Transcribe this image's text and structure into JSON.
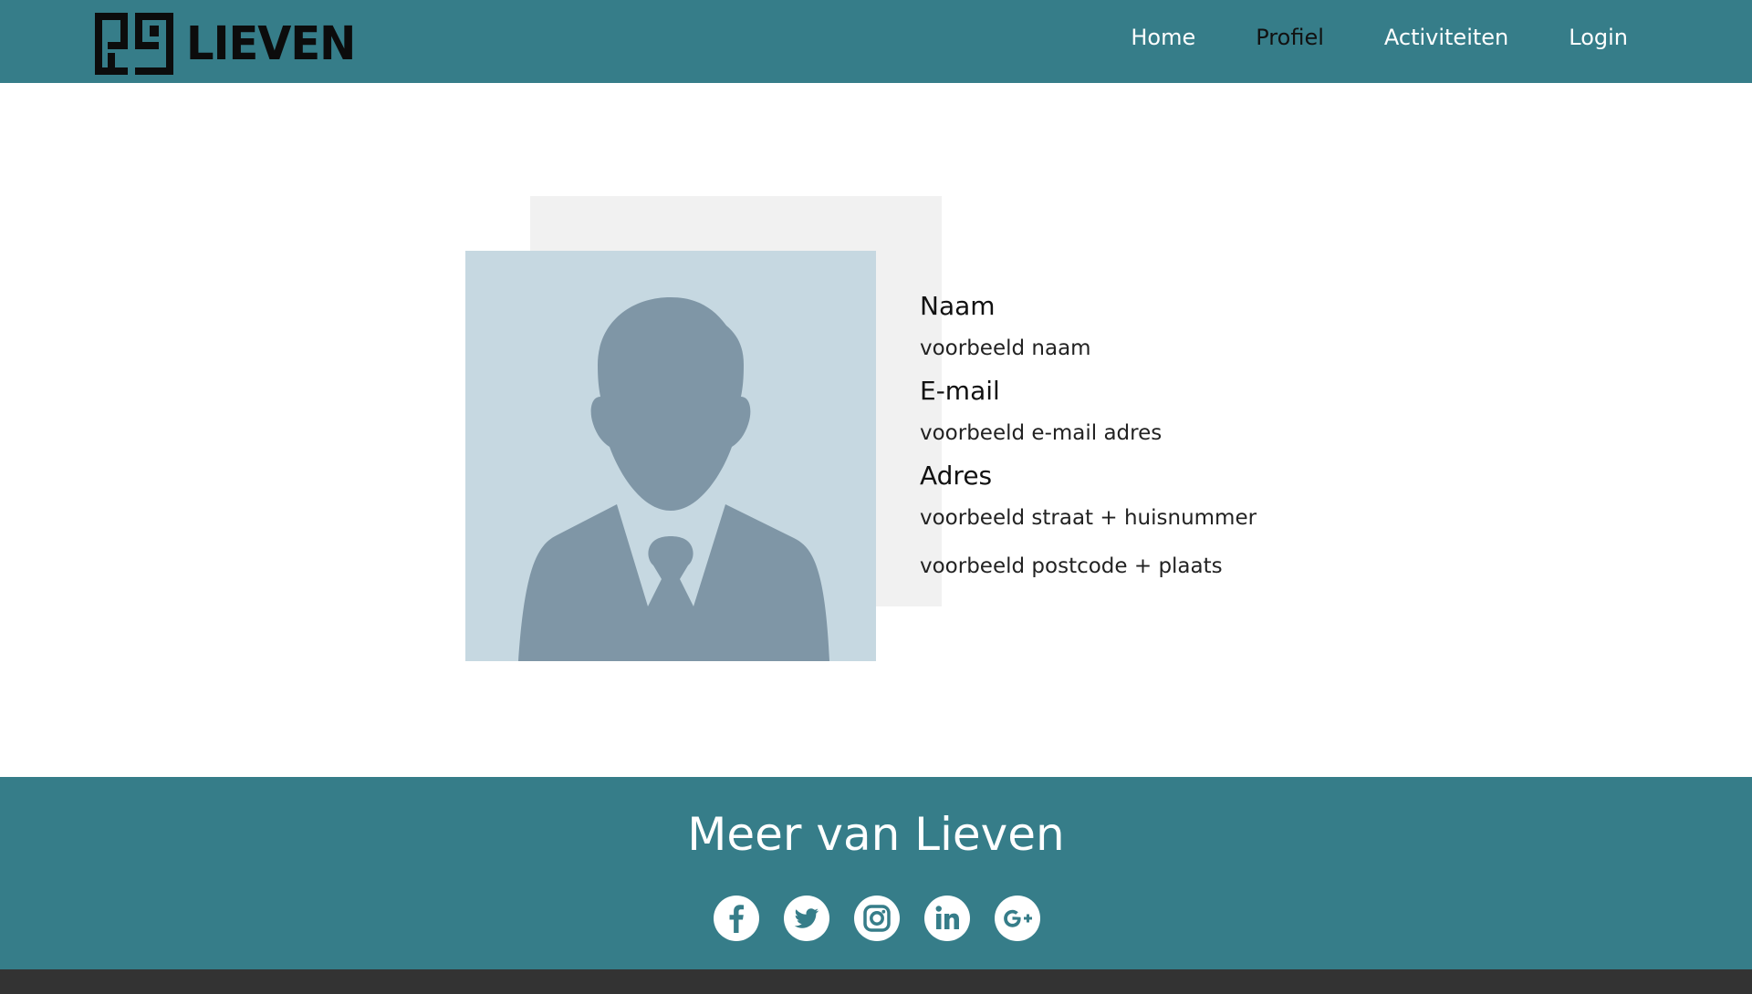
{
  "brand": {
    "name": "LIEVEN"
  },
  "nav": {
    "items": [
      {
        "label": "Home",
        "active": false
      },
      {
        "label": "Profiel",
        "active": true
      },
      {
        "label": "Activiteiten",
        "active": false
      },
      {
        "label": "Login",
        "active": false
      }
    ]
  },
  "profile": {
    "name_heading": "Naam",
    "name_value": "voorbeeld naam",
    "email_heading": "E-mail",
    "email_value": "voorbeeld e-mail adres",
    "address_heading": "Adres",
    "address_street": "voorbeeld straat + huisnummer",
    "address_city": "voorbeeld postcode + plaats"
  },
  "footer": {
    "title": "Meer van Lieven",
    "socials": [
      "facebook-icon",
      "twitter-icon",
      "instagram-icon",
      "linkedin-icon",
      "google-plus-icon"
    ]
  },
  "colors": {
    "primary": "#367d89",
    "avatar_bg": "#c6d8e1",
    "avatar_figure": "#7f96a6",
    "panel": "#f1f1f1",
    "bottom_bar": "#333333"
  }
}
